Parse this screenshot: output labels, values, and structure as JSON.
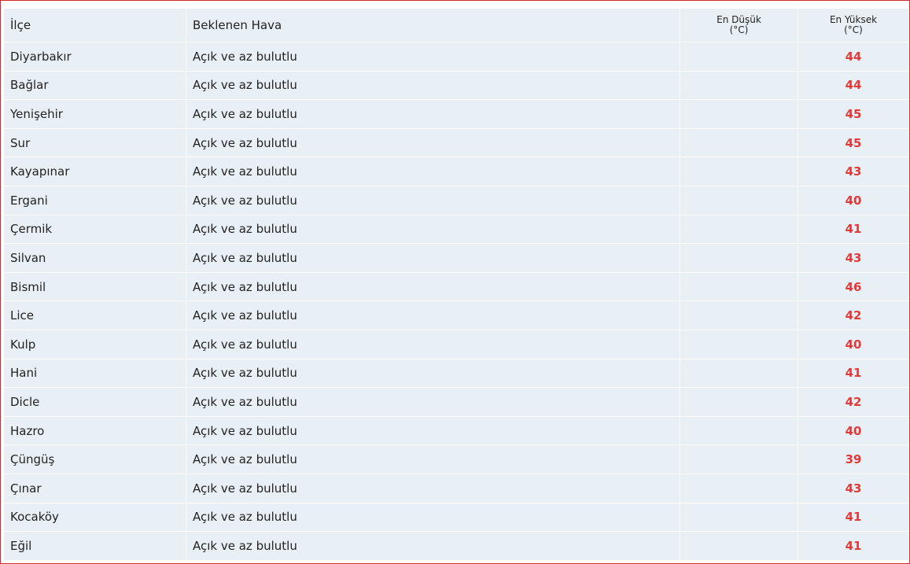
{
  "table": {
    "headers": {
      "district": "İlçe",
      "forecast": "Beklenen Hava",
      "min_line1": "En Düşük",
      "min_line2": "(°C)",
      "max_line1": "En Yüksek",
      "max_line2": "(°C)"
    },
    "rows": [
      {
        "district": "Diyarbakır",
        "forecast": "Açık ve az bulutlu",
        "min": "",
        "max": "44"
      },
      {
        "district": "Bağlar",
        "forecast": "Açık ve az bulutlu",
        "min": "",
        "max": "44"
      },
      {
        "district": "Yenişehir",
        "forecast": "Açık ve az bulutlu",
        "min": "",
        "max": "45"
      },
      {
        "district": "Sur",
        "forecast": "Açık ve az bulutlu",
        "min": "",
        "max": "45"
      },
      {
        "district": "Kayapınar",
        "forecast": "Açık ve az bulutlu",
        "min": "",
        "max": "43"
      },
      {
        "district": "Ergani",
        "forecast": "Açık ve az bulutlu",
        "min": "",
        "max": "40"
      },
      {
        "district": "Çermik",
        "forecast": "Açık ve az bulutlu",
        "min": "",
        "max": "41"
      },
      {
        "district": "Silvan",
        "forecast": "Açık ve az bulutlu",
        "min": "",
        "max": "43"
      },
      {
        "district": "Bismil",
        "forecast": "Açık ve az bulutlu",
        "min": "",
        "max": "46"
      },
      {
        "district": "Lice",
        "forecast": "Açık ve az bulutlu",
        "min": "",
        "max": "42"
      },
      {
        "district": "Kulp",
        "forecast": "Açık ve az bulutlu",
        "min": "",
        "max": "40"
      },
      {
        "district": "Hani",
        "forecast": "Açık ve az bulutlu",
        "min": "",
        "max": "41"
      },
      {
        "district": "Dicle",
        "forecast": "Açık ve az bulutlu",
        "min": "",
        "max": "42"
      },
      {
        "district": "Hazro",
        "forecast": "Açık ve az bulutlu",
        "min": "",
        "max": "40"
      },
      {
        "district": "Çüngüş",
        "forecast": "Açık ve az bulutlu",
        "min": "",
        "max": "39"
      },
      {
        "district": "Çınar",
        "forecast": "Açık ve az bulutlu",
        "min": "",
        "max": "43"
      },
      {
        "district": "Kocaköy",
        "forecast": "Açık ve az bulutlu",
        "min": "",
        "max": "41"
      },
      {
        "district": "Eğil",
        "forecast": "Açık ve az bulutlu",
        "min": "",
        "max": "41"
      }
    ]
  },
  "colors": {
    "frame_border": "#d7262d",
    "cell_background": "#e9f0f5",
    "max_temperature": "#e03a3a"
  }
}
